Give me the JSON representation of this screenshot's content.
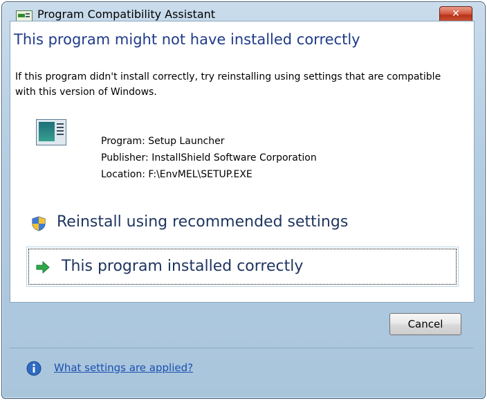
{
  "window": {
    "title": "Program Compatibility Assistant",
    "close_label": "✕"
  },
  "main": {
    "heading": "This program might not have installed correctly",
    "description": "If this program didn't install correctly, try reinstalling using settings that are compatible with this version of Windows.",
    "program_line": "Program: Setup Launcher",
    "publisher_line": "Publisher: InstallShield Software Corporation",
    "location_line": "Location: F:\\EnvMEL\\SETUP.EXE"
  },
  "options": {
    "reinstall_label": "Reinstall using recommended settings",
    "correct_label": "This program installed correctly"
  },
  "footer": {
    "cancel_label": "Cancel",
    "help_link": "What settings are applied?"
  },
  "colors": {
    "heading": "#1e3a8a",
    "option_text": "#1f3560",
    "link": "#1a4fb0",
    "close_button": "#c9452b"
  }
}
